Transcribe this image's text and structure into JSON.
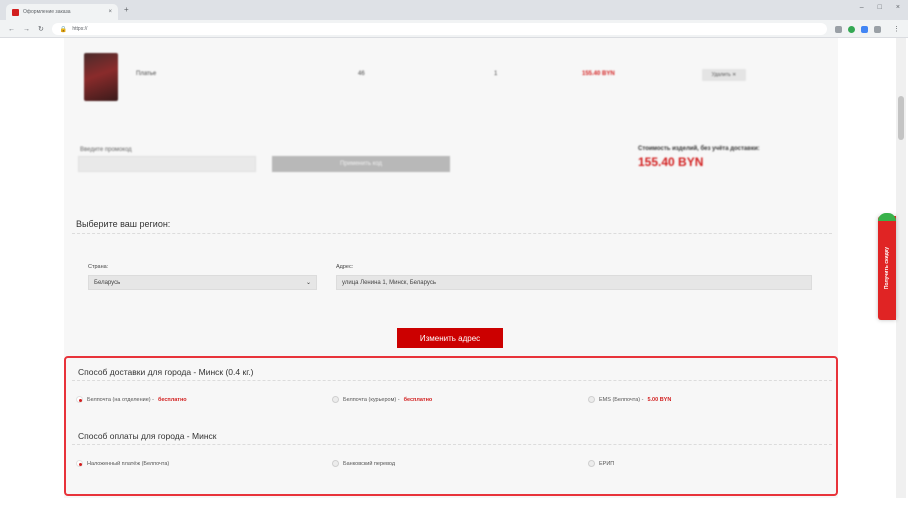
{
  "browser": {
    "tab_title": "Оформление заказа",
    "url": "https://",
    "profile": ""
  },
  "cart": {
    "product_code": "",
    "product_name": "Платье",
    "size": "46",
    "qty": "1",
    "price": "155.40 BYN",
    "remove_label": "Удалить ✕"
  },
  "promo": {
    "label": "Введите промокод",
    "button_label": "Применить код"
  },
  "total": {
    "label": "Стоимость изделий, без учёта доставки:",
    "value": "155.40 BYN"
  },
  "side_tab": {
    "label": "Получить скидку"
  },
  "region": {
    "title": "Выберите ваш регион:",
    "country_label": "Страна:",
    "country_value": "Беларусь",
    "address_label": "Адрес:",
    "address_value": "улица Ленина 1, Минск, Беларусь",
    "change_button": "Изменить адрес"
  },
  "delivery": {
    "title": "Способ доставки для города - Минск (0.4 кг.)",
    "options": [
      {
        "label": "Белпочта (на отделение) - ",
        "price": "бесплатно",
        "selected": true
      },
      {
        "label": "Белпочта (курьером) - ",
        "price": "бесплатно",
        "selected": false
      },
      {
        "label": "EMS (Белпочта) - ",
        "price": "5.00 BYN",
        "selected": false
      }
    ]
  },
  "payment": {
    "title": "Способ оплаты для города - Минск",
    "options": [
      {
        "label": "Наложенный платёж (Белпочта)",
        "selected": true
      },
      {
        "label": "Банковский перевод",
        "selected": false
      },
      {
        "label": "ЕРИП",
        "selected": false
      }
    ]
  },
  "colors": {
    "accent": "#cc0000",
    "highlight_border": "#e8333a",
    "side_tab": "#e02424"
  },
  "icons": {
    "back": "arrow-left-icon",
    "forward": "arrow-right-icon",
    "reload": "reload-icon",
    "select_chevron": "chevron-down-icon"
  }
}
